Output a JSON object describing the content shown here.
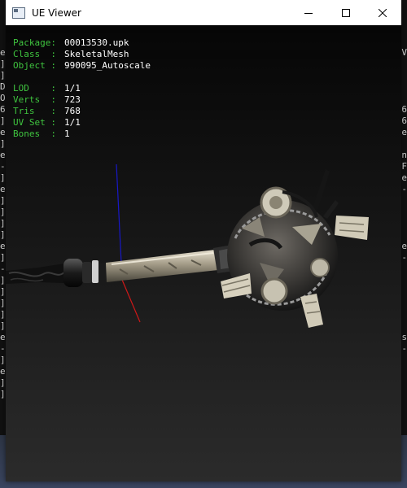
{
  "window": {
    "title": "UE Viewer"
  },
  "controls": {
    "minimize": "minimize-icon",
    "maximize": "maximize-icon",
    "close": "close-icon"
  },
  "info": {
    "package": {
      "label": "Package:",
      "value": "00013530.upk"
    },
    "class": {
      "label": "Class  :",
      "value": "SkeletalMesh"
    },
    "object": {
      "label": "Object :",
      "value": "990095_Autoscale"
    },
    "lod": {
      "label": "LOD    :",
      "value": "1/1"
    },
    "verts": {
      "label": "Verts  :",
      "value": "723"
    },
    "tris": {
      "label": "Tris   :",
      "value": "768"
    },
    "uvset": {
      "label": "UV Set :",
      "value": "1/1"
    },
    "bones": {
      "label": "Bones  :",
      "value": "1"
    }
  },
  "colors": {
    "label_green": "#3fc43f",
    "value_white": "#ffffff",
    "axis_x": "#d01818",
    "axis_z": "#1818c8"
  },
  "background_console": {
    "left_chars": [
      "e",
      "]",
      "]",
      "D",
      "O",
      "6",
      "]",
      "e",
      "]",
      "e",
      "-",
      "]",
      "e",
      "]",
      "]",
      "]",
      "]",
      "e",
      "]",
      "-",
      "]",
      "]",
      "]",
      "]",
      "]",
      "e",
      "-",
      "]",
      "e",
      "]",
      "]"
    ],
    "right_chars": [
      "V",
      "",
      "",
      "",
      "",
      "6",
      "6",
      "e",
      "",
      "n",
      "F",
      "e",
      "-",
      "",
      "",
      "",
      "",
      "e",
      "-",
      "",
      "",
      "",
      "",
      "",
      "",
      "s",
      "-",
      "",
      "",
      "",
      ""
    ]
  }
}
